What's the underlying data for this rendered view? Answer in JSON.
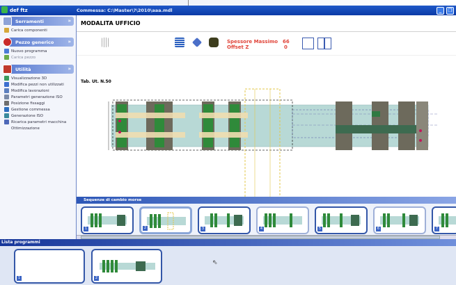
{
  "app": {
    "title": "def ftz",
    "path_title": "Commessa: C:\\Master\\?\\2010\\aaa.mdl",
    "window_buttons": [
      "_",
      "❐"
    ]
  },
  "sidebar": {
    "sections": [
      {
        "label": "Serramenti",
        "items": [
          "Carica componenti"
        ]
      },
      {
        "label": "Pezzo generico",
        "items": [
          "Nuovo programma",
          "Carica pezzo"
        ]
      },
      {
        "label": "Utilità",
        "items": [
          "Visualizzazione 3D",
          "Modifica pezzi non utilizzati",
          "Modifica lavorazioni",
          "Parametri generazione ISO",
          "Posizione fissaggi",
          "Gestione commessa",
          "Generazione ISO",
          "Ricarica parametri macchina",
          "Ottimizzazione"
        ]
      }
    ]
  },
  "main": {
    "mode_title": "MODALITA UFFICIO",
    "spessore_label": "Spessore Massimo",
    "spessore_value": "66",
    "offset_label": "Offset Z",
    "offset_value": "0",
    "table_label": "Tab. Ut. N.50",
    "strip_title": "Sequenze di cambio morse",
    "thumb_numbers": [
      "1",
      "2",
      "3",
      "4",
      "5",
      "6",
      "7"
    ]
  },
  "bottom": {
    "title": "Lista programmi",
    "thumb_numbers": [
      "1",
      "2"
    ]
  },
  "colors": {
    "titlebar": "#1e58c8",
    "accent": "#3457a8",
    "red_text": "#e0453a",
    "green_block": "#2f8a3a",
    "beam": "#b8d9d6"
  }
}
